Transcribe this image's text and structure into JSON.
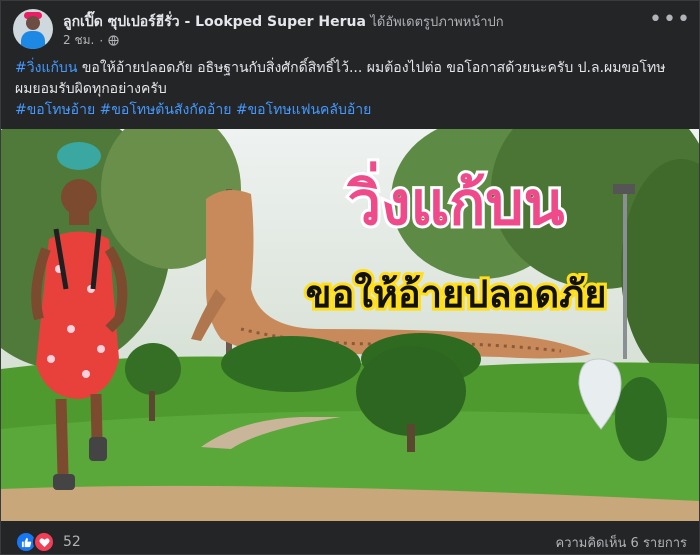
{
  "post": {
    "author": "ลูกเปิ๊ด ซุปเปอร์ฮีรั่ว - Lookped Super Herua",
    "action": "ได้อัพเดตรูปภาพหน้าปก",
    "time": "2 ชม.",
    "more_glyph": "•••",
    "caption": {
      "tag1": "#วิ่งแก้บน",
      "text": " ขอให้อ้ายปลอดภัย อธิษฐานกับสิ่งศักดิ์สิทธิ์ไว้... ผมต้องไปต่อ ขอโอกาสด้วยนะครับ ป.ล.ผมขอโทษ ผมยอมรับผิดทุกอย่างครับ",
      "tags2": [
        "#ขอโทษอ้าย",
        "#ขอโทษต้นสังกัดอ้าย",
        "#ขอโทษแฟนคลับอ้าย"
      ]
    },
    "photo": {
      "title": "วิ่งแก้บน",
      "subtitle": "ขอให้อ้ายปลอดภัย"
    },
    "reaction_count": "52",
    "comments_label": "ความคิดเห็น 6 รายการ"
  },
  "colors": {
    "background": "#242526",
    "text": "#e4e6eb",
    "secondary": "#b0b3b8",
    "link": "#4599ff",
    "title_pink": "#ef4b8b"
  }
}
